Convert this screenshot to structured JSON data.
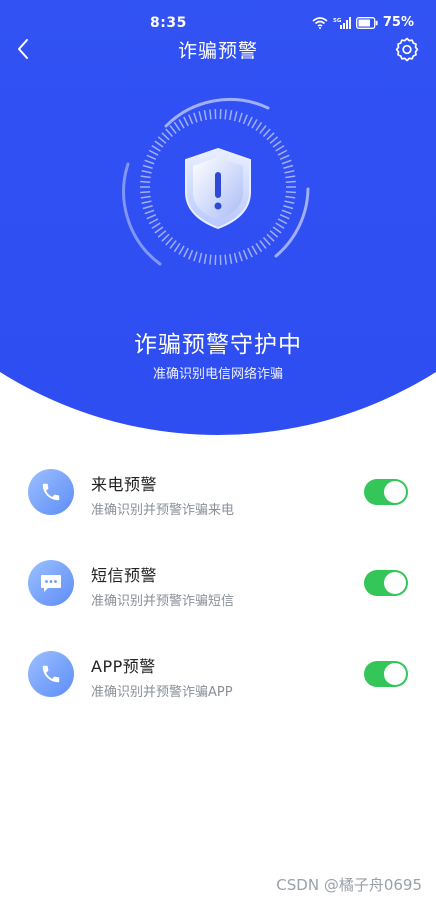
{
  "status_bar": {
    "time": "8:35",
    "network": "5G",
    "battery": "75%"
  },
  "nav": {
    "title": "诈骗预警",
    "back_icon": "chevron-left-icon",
    "settings_icon": "gear-icon"
  },
  "hero": {
    "shield_icon": "shield-exclamation-icon",
    "title": "诈骗预警守护中",
    "subtitle": "准确识别电信网络诈骗"
  },
  "features": [
    {
      "icon": "phone-icon",
      "title": "来电预警",
      "desc": "准确识别并预警诈骗来电",
      "enabled": true
    },
    {
      "icon": "message-icon",
      "title": "短信预警",
      "desc": "准确识别并预警诈骗短信",
      "enabled": true
    },
    {
      "icon": "phone-icon",
      "title": "APP预警",
      "desc": "准确识别并预警诈骗APP",
      "enabled": true
    }
  ],
  "watermark": "CSDN @橘子舟0695",
  "colors": {
    "primary": "#3050f3",
    "toggle_on": "#34c659"
  }
}
